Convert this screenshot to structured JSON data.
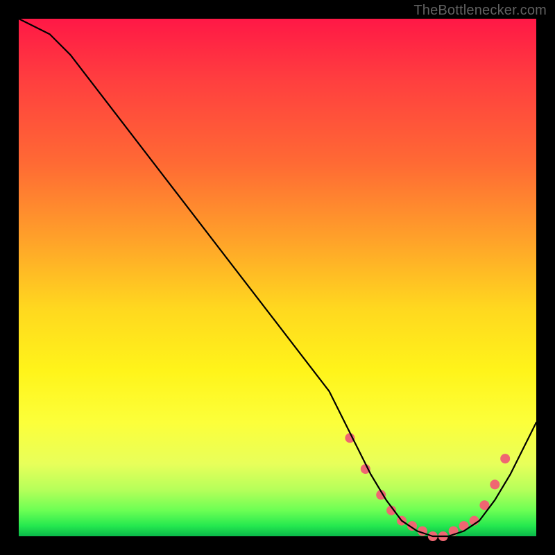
{
  "attribution": "TheBottlenecker.com",
  "chart_data": {
    "type": "line",
    "title": "",
    "xlabel": "",
    "ylabel": "",
    "xlim": [
      0,
      100
    ],
    "ylim": [
      0,
      100
    ],
    "series": [
      {
        "name": "curve",
        "x": [
          0,
          6,
          10,
          20,
          30,
          40,
          50,
          60,
          64,
          68,
          71,
          74,
          77,
          80,
          83,
          86,
          89,
          92,
          95,
          100
        ],
        "y": [
          100,
          97,
          93,
          80,
          67,
          54,
          41,
          28,
          20,
          12,
          7,
          3,
          1,
          0,
          0,
          1,
          3,
          7,
          12,
          22
        ]
      }
    ],
    "markers": {
      "name": "trough-markers",
      "x": [
        64,
        67,
        70,
        72,
        74,
        76,
        78,
        80,
        82,
        84,
        86,
        88,
        90,
        92,
        94
      ],
      "y": [
        19,
        13,
        8,
        5,
        3,
        2,
        1,
        0,
        0,
        1,
        2,
        3,
        6,
        10,
        15
      ],
      "color": "#ef6672",
      "radius": 7
    }
  }
}
